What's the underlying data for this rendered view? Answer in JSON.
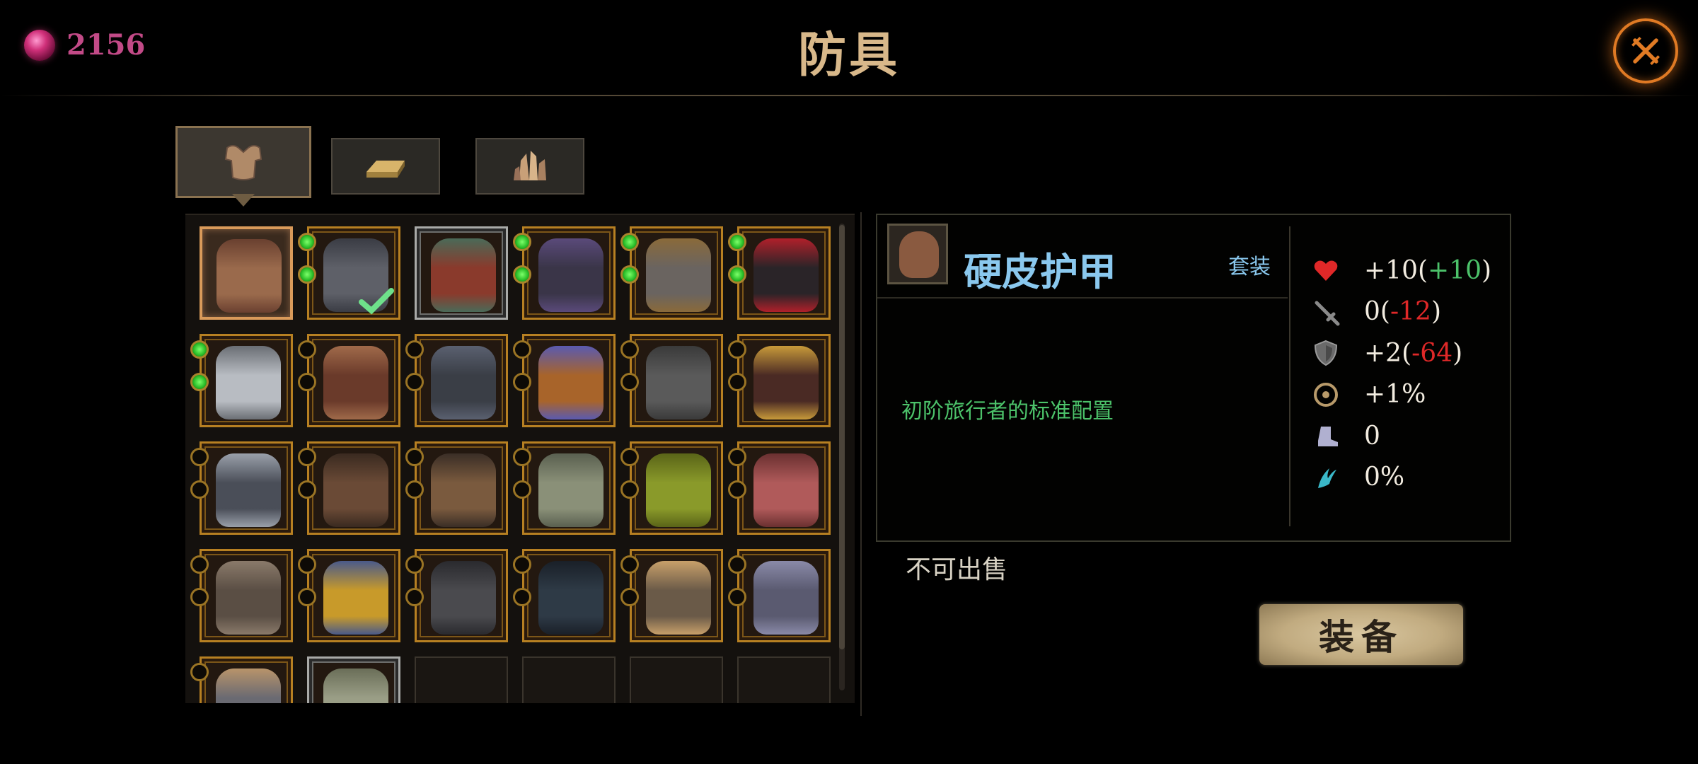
{
  "currency": {
    "icon": "gem-icon",
    "value": "2156"
  },
  "title": "防具",
  "tabs": [
    {
      "icon": "chest-armor-icon",
      "active": true
    },
    {
      "icon": "ingot-icon",
      "active": false
    },
    {
      "icon": "crystal-icon",
      "active": false
    }
  ],
  "grid": {
    "columns": 6,
    "slots": [
      {
        "style": "selected",
        "color": "#9a6a4c",
        "accent": "#6a4030",
        "sockets": 0,
        "filled": 0
      },
      {
        "style": "gold",
        "color": "#5e6068",
        "accent": "#3a3c44",
        "sockets": 2,
        "filled": 2,
        "equipped": true
      },
      {
        "style": "silver",
        "color": "#8a3a2c",
        "accent": "#4a6a58",
        "sockets": 0,
        "filled": 0
      },
      {
        "style": "gold",
        "color": "#3a3548",
        "accent": "#5a4a7a",
        "sockets": 2,
        "filled": 2
      },
      {
        "style": "gold",
        "color": "#6a6460",
        "accent": "#8a6a3a",
        "sockets": 2,
        "filled": 2
      },
      {
        "style": "gold",
        "color": "#2a2428",
        "accent": "#b0202a",
        "sockets": 2,
        "filled": 2
      },
      {
        "style": "gold",
        "color": "#b8bcc2",
        "accent": "#6a6e74",
        "sockets": 2,
        "filled": 2
      },
      {
        "style": "gold",
        "color": "#6a3a2a",
        "accent": "#a06a4a",
        "sockets": 2,
        "filled": 0
      },
      {
        "style": "gold",
        "color": "#3a3e46",
        "accent": "#5a6070",
        "sockets": 2,
        "filled": 0
      },
      {
        "style": "gold",
        "color": "#a8642a",
        "accent": "#5a5ab0",
        "sockets": 2,
        "filled": 0
      },
      {
        "style": "gold",
        "color": "#5a5a5a",
        "accent": "#3a3a3a",
        "sockets": 2,
        "filled": 0
      },
      {
        "style": "gold",
        "color": "#4a2a24",
        "accent": "#c89a3a",
        "sockets": 2,
        "filled": 0
      },
      {
        "style": "gold",
        "color": "#4a4e58",
        "accent": "#9aa0aa",
        "sockets": 2,
        "filled": 0
      },
      {
        "style": "gold",
        "color": "#6a4a36",
        "accent": "#3a2a20",
        "sockets": 2,
        "filled": 0
      },
      {
        "style": "gold",
        "color": "#7a5a3e",
        "accent": "#3a2e26",
        "sockets": 2,
        "filled": 0
      },
      {
        "style": "gold",
        "color": "#8a9078",
        "accent": "#5a6050",
        "sockets": 2,
        "filled": 0
      },
      {
        "style": "gold",
        "color": "#8a9a2a",
        "accent": "#5a6418",
        "sockets": 2,
        "filled": 0
      },
      {
        "style": "gold",
        "color": "#b05a5a",
        "accent": "#6a3030",
        "sockets": 2,
        "filled": 0
      },
      {
        "style": "gold",
        "color": "#5a4e44",
        "accent": "#8a7a6a",
        "sockets": 2,
        "filled": 0
      },
      {
        "style": "gold",
        "color": "#c89a2a",
        "accent": "#4a5a8a",
        "sockets": 2,
        "filled": 0
      },
      {
        "style": "gold",
        "color": "#4a4a4e",
        "accent": "#2a2a2e",
        "sockets": 2,
        "filled": 0
      },
      {
        "style": "gold",
        "color": "#2e3a46",
        "accent": "#1a2028",
        "sockets": 2,
        "filled": 0
      },
      {
        "style": "gold",
        "color": "#6a5a48",
        "accent": "#c8a06a",
        "sockets": 2,
        "filled": 0
      },
      {
        "style": "gold",
        "color": "#5a5a70",
        "accent": "#8a8aa8",
        "sockets": 2,
        "filled": 0
      },
      {
        "style": "gold",
        "color": "#6a6a72",
        "accent": "#b8946a",
        "sockets": 1,
        "filled": 0
      },
      {
        "style": "silver",
        "color": "#9a9e86",
        "accent": "#6a6e58",
        "sockets": 0,
        "filled": 0
      },
      {
        "style": "empty"
      },
      {
        "style": "empty"
      },
      {
        "style": "empty"
      },
      {
        "style": "empty"
      }
    ]
  },
  "detail": {
    "name": "硬皮护甲",
    "set_label": "套装",
    "description": "初阶旅行者的标准配置",
    "stats": [
      {
        "icon": "heart-icon",
        "parts": [
          [
            "+10(",
            ""
          ],
          [
            "+10",
            "pos"
          ],
          [
            ")",
            ""
          ]
        ]
      },
      {
        "icon": "sword-icon",
        "parts": [
          [
            "0(",
            ""
          ],
          [
            "-12",
            "neg"
          ],
          [
            ")",
            ""
          ]
        ]
      },
      {
        "icon": "shield-icon",
        "parts": [
          [
            "+2(",
            ""
          ],
          [
            "-64",
            "neg"
          ],
          [
            ")",
            ""
          ]
        ]
      },
      {
        "icon": "crosshair-icon",
        "parts": [
          [
            "+1%",
            ""
          ]
        ]
      },
      {
        "icon": "boot-icon",
        "parts": [
          [
            "0",
            ""
          ]
        ]
      },
      {
        "icon": "claw-icon",
        "parts": [
          [
            "0%",
            ""
          ]
        ]
      }
    ],
    "sell_status": "不可出售",
    "equip_label": "装备"
  },
  "colors": {
    "accent_gold": "#b78022",
    "title": "#d8b88a",
    "name": "#8ac8ee",
    "positive": "#4cc26a",
    "negative": "#e02828"
  }
}
